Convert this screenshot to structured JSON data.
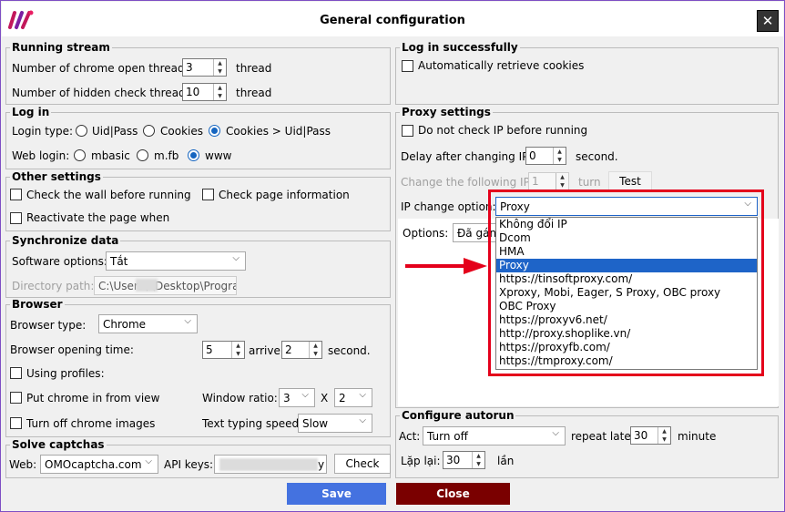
{
  "window": {
    "title": "General configuration",
    "close_label": "✕"
  },
  "running": {
    "title": "Running stream",
    "open_threads_label": "Number of chrome open threads:",
    "open_threads": "3",
    "hidden_threads_label": "Number of hidden check threads:",
    "hidden_threads": "10",
    "unit": "thread"
  },
  "login": {
    "title": "Log in",
    "type_label": "Login type:",
    "types": [
      "Uid|Pass",
      "Cookies",
      "Cookies > Uid|Pass"
    ],
    "web_label": "Web login:",
    "webs": [
      "mbasic",
      "m.fb",
      "www"
    ]
  },
  "other": {
    "title": "Other settings",
    "check_wall": "Check the wall before running",
    "check_page": "Check page information",
    "reactivate": "Reactivate the page when"
  },
  "sync": {
    "title": "Synchronize data",
    "software_label": "Software options:",
    "software_value": "Tắt",
    "dir_label": "Directory path:",
    "dir_value": "C:\\Users\\         \\Desktop\\Progra"
  },
  "browser": {
    "title": "Browser",
    "type_label": "Browser type:",
    "type_value": "Chrome",
    "open_time_label": "Browser opening time:",
    "open_from": "5",
    "arrive": "arrive",
    "open_to": "2",
    "second": "second.",
    "profiles": "Using profiles:",
    "put_view": "Put chrome in from view",
    "window_ratio_label": "Window ratio:",
    "ratio_w": "3",
    "x": "X",
    "ratio_h": "2",
    "turn_off_images": "Turn off chrome images",
    "typing_label": "Text typing speed:",
    "typing_value": "Slow"
  },
  "captcha": {
    "title": "Solve captchas",
    "web_label": "Web:",
    "web_value": "OMOcaptcha.com",
    "api_label": "API keys:",
    "api_tail": "y",
    "check": "Check"
  },
  "login_ok": {
    "title": "Log in successfully",
    "auto_cookies": "Automatically retrieve cookies"
  },
  "proxy": {
    "title": "Proxy settings",
    "no_check_ip": "Do not check IP before running",
    "delay_label": "Delay after changing IP:",
    "delay": "0",
    "second": "second.",
    "change_label": "Change the following IP:",
    "change_value": "1",
    "turn": "turn",
    "test": "Test",
    "ip_option_label": "IP change option:",
    "ip_option_value": "Proxy",
    "options_label": "Options:",
    "options_value": "Đã gán",
    "options_list": [
      "Không đổi IP",
      "Dcom",
      "HMA",
      "Proxy",
      "https://tinsoftproxy.com/",
      "Xproxy, Mobi, Eager, S Proxy, OBC proxy",
      "OBC Proxy",
      "https://proxyv6.net/",
      "http://proxy.shoplike.vn/",
      "https://proxyfb.com/",
      "https://tmproxy.com/"
    ]
  },
  "autorun": {
    "title": "Configure autorun",
    "act_label": "Act:",
    "act_value": "Turn off",
    "repeat_label": "repeat later",
    "repeat": "30",
    "minute": "minute",
    "lap_label": "Lặp lại:",
    "lap": "30",
    "lan": "lần"
  },
  "actions": {
    "save": "Save",
    "close": "Close"
  },
  "colors": {
    "save": "#4472e0",
    "close": "#7a0000",
    "highlight": "#e4001b"
  }
}
